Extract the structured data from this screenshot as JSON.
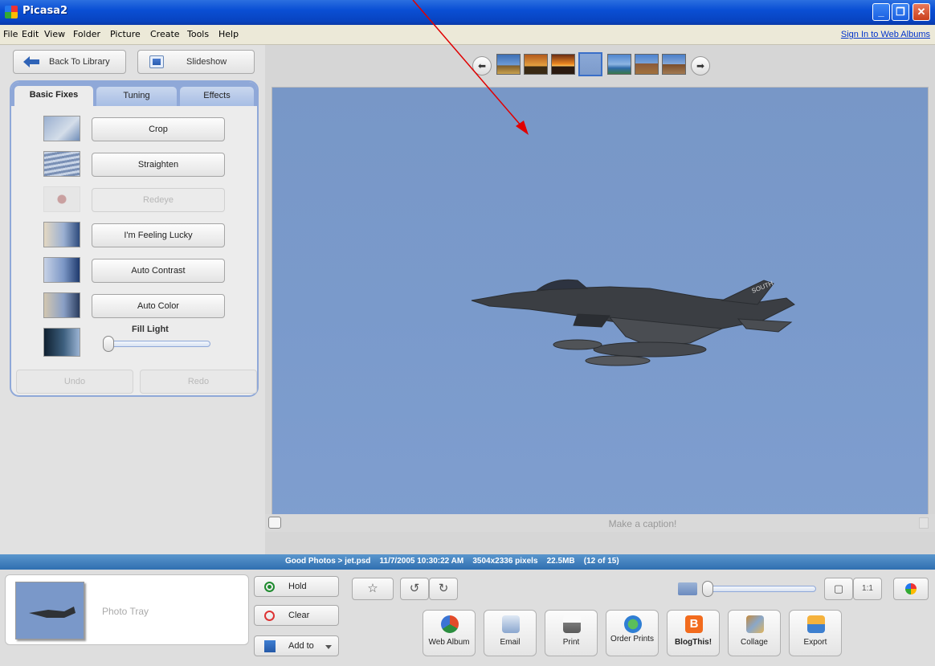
{
  "window": {
    "title": "Picasa2",
    "min_glyph": "_",
    "max_glyph": "❐",
    "close_glyph": "✕"
  },
  "menu": {
    "items": [
      "File",
      "Edit",
      "View",
      "Folder",
      "Picture",
      "Create",
      "Tools",
      "Help"
    ],
    "signin": "Sign In to Web Albums"
  },
  "left": {
    "back_label": "Back To Library",
    "slideshow_label": "Slideshow",
    "tabs": [
      "Basic Fixes",
      "Tuning",
      "Effects"
    ],
    "fixes": [
      {
        "label": "Crop",
        "enabled": true
      },
      {
        "label": "Straighten",
        "enabled": true
      },
      {
        "label": "Redeye",
        "enabled": false
      },
      {
        "label": "I'm Feeling Lucky",
        "enabled": true
      },
      {
        "label": "Auto Contrast",
        "enabled": true
      },
      {
        "label": "Auto Color",
        "enabled": true
      }
    ],
    "fill_light_label": "Fill Light",
    "fill_light_value": 0,
    "undo_label": "Undo",
    "redo_label": "Redo"
  },
  "viewer": {
    "prev_glyph": "⬅",
    "next_glyph": "➡",
    "caption_placeholder": "Make a caption!"
  },
  "status": {
    "text": "Good Photos > jet.psd    11/7/2005 10:30:22 AM    3504x2336 pixels    22.5MB    (12 of 15)"
  },
  "tray": {
    "label": "Photo Tray",
    "hold_label": "Hold",
    "clear_label": "Clear",
    "addto_label": "Add to"
  },
  "toolbar": {
    "star_glyph": "☆",
    "rotate_left_glyph": "↺",
    "rotate_right_glyph": "↻",
    "fit_glyph": "▢",
    "actual_size_label": "1:1"
  },
  "actions": [
    {
      "label": "Web Album",
      "icon": "web-album-icon",
      "color": "#e24b2a"
    },
    {
      "label": "Email",
      "icon": "email-icon",
      "color": "#6f8fb8"
    },
    {
      "label": "Print",
      "icon": "print-icon",
      "color": "#7a7a7a"
    },
    {
      "label": "Order Prints",
      "icon": "order-prints-icon",
      "color": "#3a8fd4"
    },
    {
      "label": "BlogThis!",
      "icon": "blogger-icon",
      "color": "#f26b1d"
    },
    {
      "label": "Collage",
      "icon": "collage-icon",
      "color": "#b5792b"
    },
    {
      "label": "Export",
      "icon": "export-icon",
      "color": "#3d7fcf"
    }
  ],
  "colors": {
    "titlebar": "#0a4fd4",
    "statusbar": "#2f6fb0",
    "sky": "#7897c7",
    "annotation_arrow": "#e00000"
  }
}
